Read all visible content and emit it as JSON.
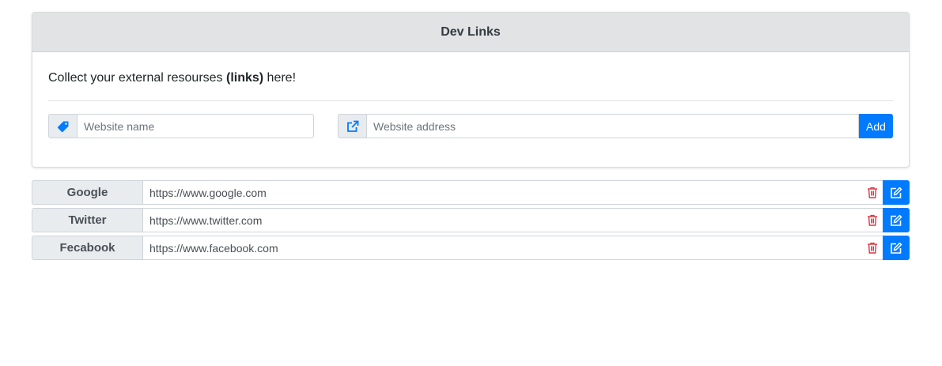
{
  "colors": {
    "accent": "#007bff",
    "danger": "#dc3545",
    "header_bg": "#e2e3e5",
    "addon_bg": "#e9ecef"
  },
  "card": {
    "title": "Dev Links",
    "intro": {
      "before": "Collect your external resourses ",
      "bold": "(links)",
      "after": " here!"
    },
    "form": {
      "name_icon": "tag-icon",
      "name_placeholder": "Website name",
      "name_value": "",
      "address_icon": "external-link-icon",
      "address_placeholder": "Website address",
      "address_value": "",
      "add_label": "Add"
    }
  },
  "links": [
    {
      "name": "Google",
      "url": "https://www.google.com"
    },
    {
      "name": "Twitter",
      "url": "https://www.twitter.com"
    },
    {
      "name": "Fecabook",
      "url": "https://www.facebook.com"
    }
  ],
  "row_icons": {
    "delete": "trash-icon",
    "edit": "edit-icon"
  }
}
